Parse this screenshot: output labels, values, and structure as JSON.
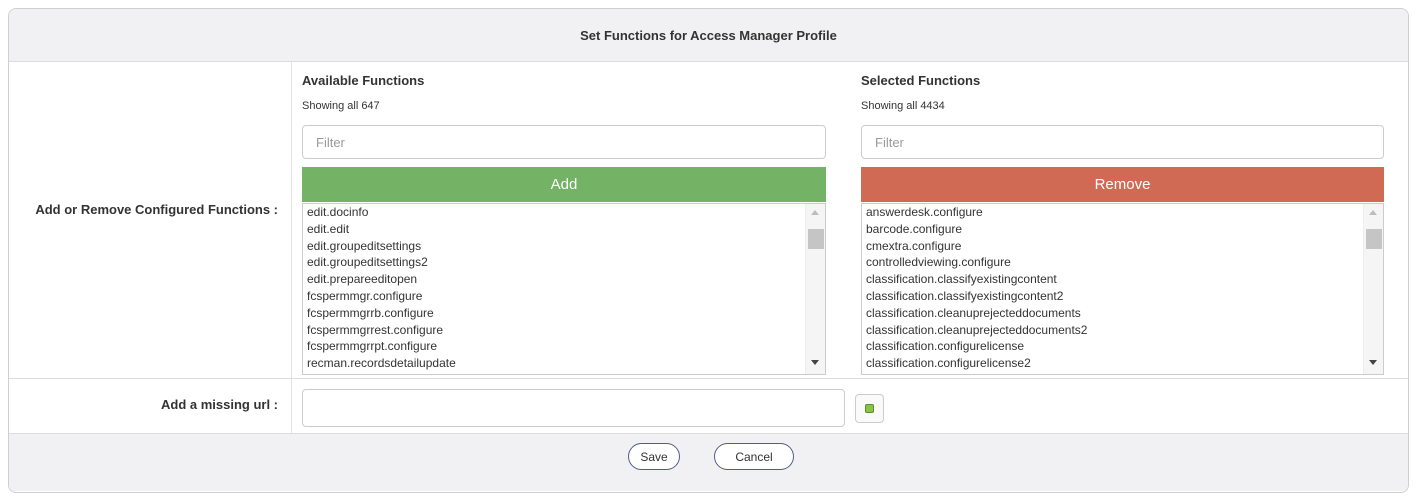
{
  "header": {
    "title": "Set Functions for Access Manager Profile"
  },
  "main": {
    "label": "Add or Remove Configured Functions :"
  },
  "available": {
    "title": "Available Functions",
    "count": "Showing all 647",
    "filter_placeholder": "Filter",
    "button_label": "Add",
    "button_color": "#74b265",
    "items": [
      "edit.docinfo",
      "edit.edit",
      "edit.groupeditsettings",
      "edit.groupeditsettings2",
      "edit.prepareeditopen",
      "fcspermmgr.configure",
      "fcspermmgrrb.configure",
      "fcspermmgrrest.configure",
      "fcspermmgrrpt.configure",
      "recman.recordsdetailupdate"
    ]
  },
  "selected": {
    "title": "Selected Functions",
    "count": "Showing all 4434",
    "filter_placeholder": "Filter",
    "button_label": "Remove",
    "button_color": "#d06a55",
    "items": [
      "answerdesk.configure",
      "barcode.configure",
      "cmextra.configure",
      "controlledviewing.configure",
      "classification.classifyexistingcontent",
      "classification.classifyexistingcontent2",
      "classification.cleanuprejecteddocuments",
      "classification.cleanuprejecteddocuments2",
      "classification.configurelicense",
      "classification.configurelicense2"
    ]
  },
  "missing_url": {
    "label": "Add a missing url :",
    "value": "",
    "add_icon": "plus-icon"
  },
  "footer": {
    "save_label": "Save",
    "cancel_label": "Cancel"
  }
}
